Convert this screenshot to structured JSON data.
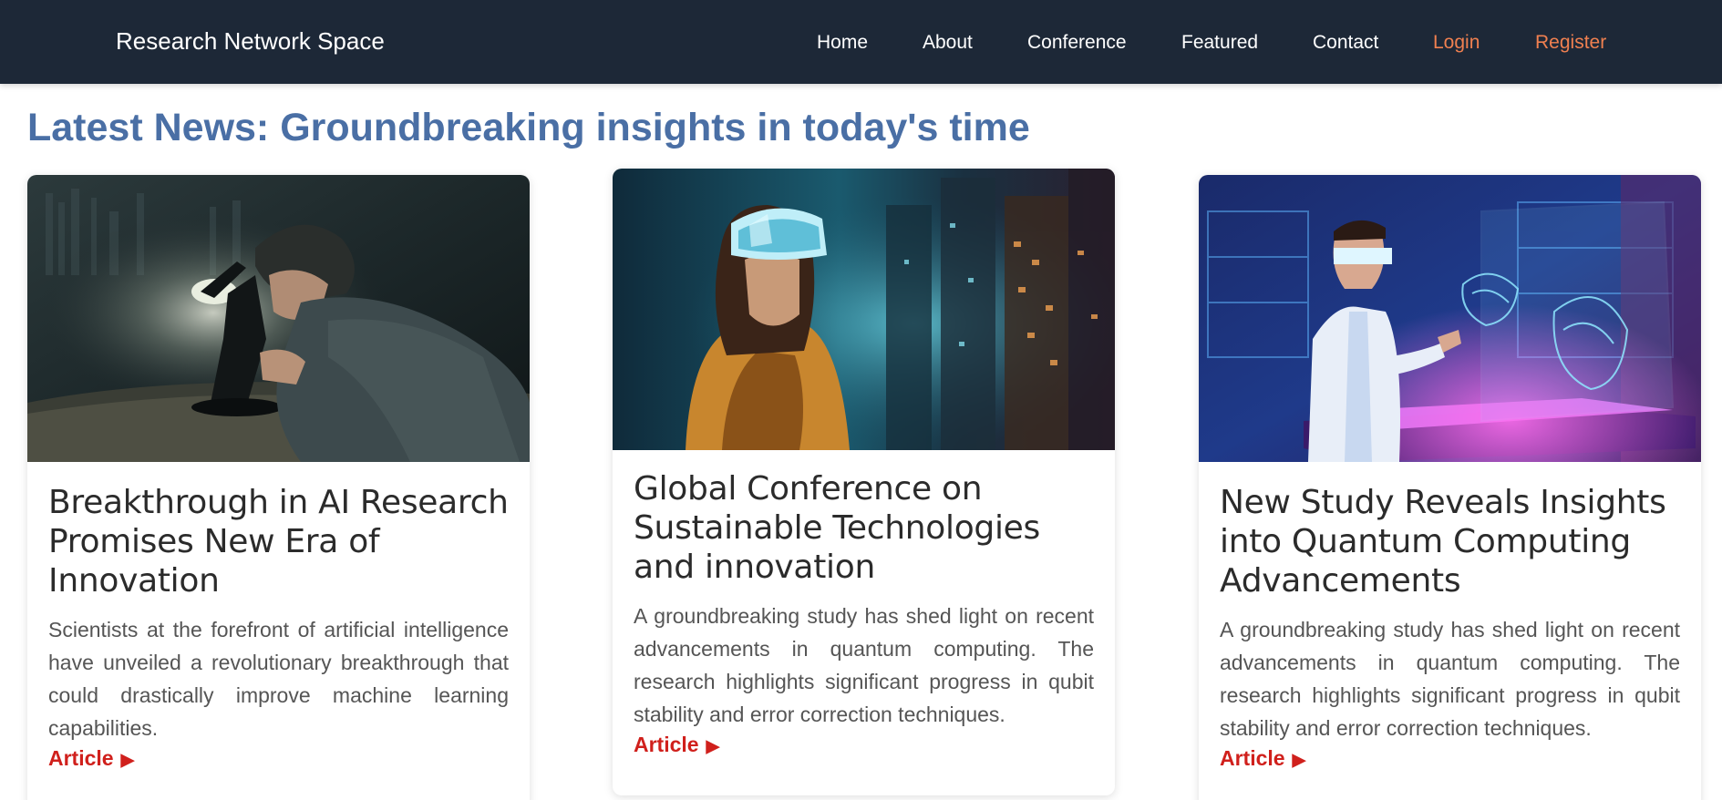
{
  "header": {
    "brand": "Research Network Space",
    "nav": [
      {
        "label": "Home"
      },
      {
        "label": "About"
      },
      {
        "label": "Conference"
      },
      {
        "label": "Featured"
      },
      {
        "label": "Contact"
      },
      {
        "label": "Login"
      },
      {
        "label": "Register"
      }
    ]
  },
  "main": {
    "headline": "Latest News: Groundbreaking insights in today's time",
    "cards": [
      {
        "title": "Breakthrough in AI Research Promises New Era of Innovation",
        "text": "Scientists at the forefront of artificial intelligence have unveiled a revolutionary breakthrough that could drastically improve machine learning capabilities.",
        "link": "Article",
        "link_icon": "play-arrow-icon",
        "image": "scientist-microscope-photo"
      },
      {
        "title": "Global Conference on Sustainable Technologies and innovation",
        "text": "A groundbreaking study has shed light on recent advancements in quantum computing. The research highlights significant progress in qubit stability and error correction techniques.",
        "link": "Article",
        "link_icon": "play-arrow-icon",
        "image": "woman-vr-headset-city-photo"
      },
      {
        "title": "New Study Reveals Insights into Quantum Computing Advancements",
        "text": "A groundbreaking study has shed light on recent advancements in quantum computing. The research highlights significant progress in qubit stability and error correction techniques.",
        "link": "Article",
        "link_icon": "play-arrow-icon",
        "image": "scientist-hologram-lab-photo"
      }
    ]
  },
  "colors": {
    "navbar_bg": "#1d2837",
    "headline": "#4a6fa5",
    "accent_nav": "#f08050",
    "article_link": "#d0201c"
  }
}
